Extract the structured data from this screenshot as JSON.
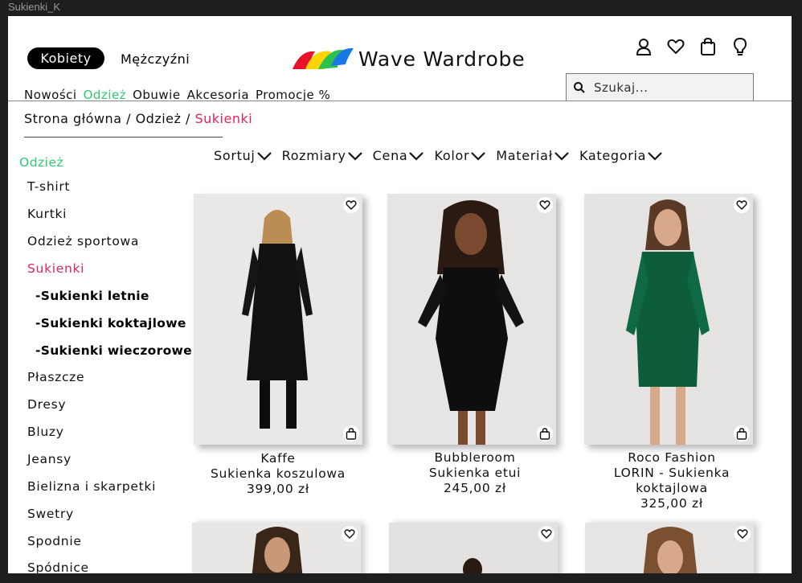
{
  "window": {
    "title": "Sukienki_K"
  },
  "header": {
    "gender_active": "Kobiety",
    "gender_other": "Mężczyźni",
    "brand": "Wave Wardrobe",
    "search_placeholder": "Szukaj...",
    "nav": [
      "Nowości",
      "Odzież",
      "Obuwie",
      "Akcesoria",
      "Promocje %"
    ],
    "nav_active_index": 1,
    "icons": [
      "user-icon",
      "heart-icon",
      "shopping-bag-icon",
      "lightbulb-icon"
    ]
  },
  "breadcrumb": {
    "home": "Strona główna",
    "sep": " / ",
    "parent": "Odzież",
    "current": "Sukienki"
  },
  "sidebar": {
    "heading": "Odzież",
    "items": [
      "T-shirt",
      "Kurtki",
      "Odzież sportowa",
      "Sukienki",
      "Płaszcze",
      "Dresy",
      "Bluzy",
      "Jeansy",
      "Bielizna i skarpetki",
      "Swetry",
      "Spodnie",
      "Spódnice"
    ],
    "active_index": 3,
    "subitems": [
      "-Sukienki letnie",
      "-Sukienki koktajlowe",
      "-Sukienki wieczorowe"
    ]
  },
  "filters": [
    "Sortuj",
    "Rozmiary",
    "Cena",
    "Kolor",
    "Materiał",
    "Kategoria"
  ],
  "products": [
    {
      "brand": "Kaffe",
      "name": "Sukienka koszulowa",
      "price": "399,00 zł",
      "color": "#000000"
    },
    {
      "brand": "Bubbleroom",
      "name": "Sukienka etui",
      "price": "245,00 zł",
      "color": "#000000"
    },
    {
      "brand": "Roco Fashion",
      "name": "LORIN - Sukienka koktajlowa",
      "name_line1": "LORIN - Sukienka",
      "name_line2": "koktajlowa",
      "price": "325,00 zł",
      "color": "#0d5c3a"
    }
  ],
  "colors": {
    "accent_green": "#2ecc71",
    "accent_pink": "#e0245e"
  }
}
